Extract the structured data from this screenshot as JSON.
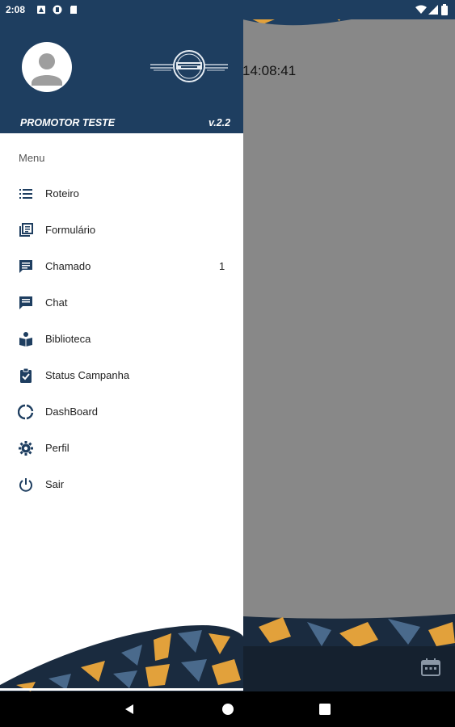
{
  "status_bar": {
    "time": "2:08"
  },
  "background": {
    "time": "14:08:41"
  },
  "drawer": {
    "user_name": "PROMOTOR TESTE",
    "version": "v.2.2",
    "menu_heading": "Menu",
    "items": [
      {
        "label": "Roteiro",
        "icon": "list-icon"
      },
      {
        "label": "Formulário",
        "icon": "library-books-icon"
      },
      {
        "label": "Chamado",
        "icon": "message-icon",
        "badge": "1"
      },
      {
        "label": "Chat",
        "icon": "chat-icon"
      },
      {
        "label": "Biblioteca",
        "icon": "book-reader-icon"
      },
      {
        "label": "Status Campanha",
        "icon": "assignment-check-icon"
      },
      {
        "label": "DashBoard",
        "icon": "donut-chart-icon"
      },
      {
        "label": "Perfil",
        "icon": "settings-icon"
      },
      {
        "label": "Sair",
        "icon": "power-icon"
      }
    ]
  },
  "colors": {
    "header": "#1e3e60",
    "accent_orange": "#e2a13b",
    "camo_blue": "#4a6a8c",
    "scrim": "#888888"
  }
}
